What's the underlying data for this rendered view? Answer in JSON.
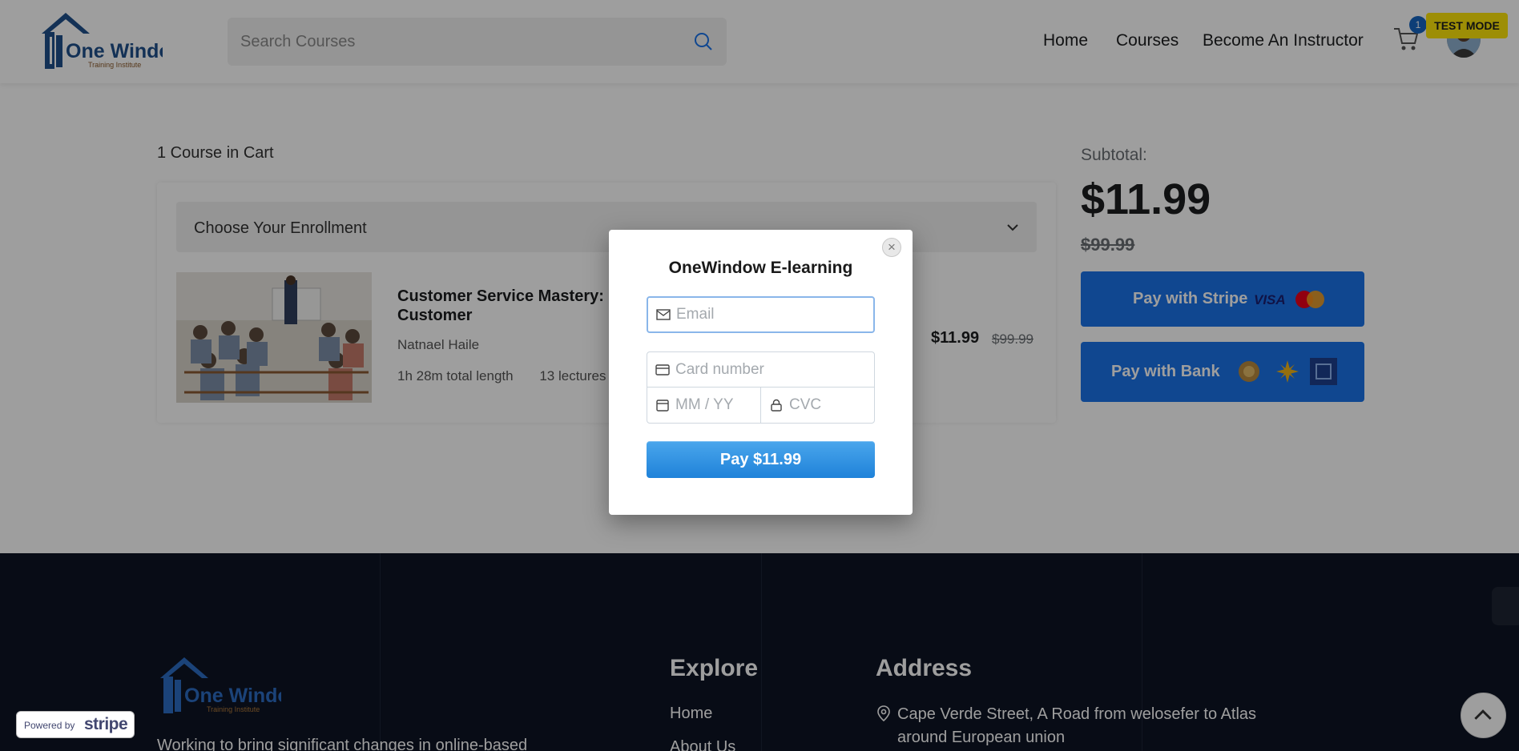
{
  "header": {
    "logo_text": "One Window",
    "logo_sub": "Training Institute",
    "search_placeholder": "Search Courses",
    "nav": [
      "Home",
      "Courses",
      "Become An Instructor"
    ],
    "cart_count": "1",
    "test_mode": "TEST MODE"
  },
  "cart": {
    "count_label": "1 Course in Cart",
    "enrollment_label": "Choose Your Enrollment",
    "course": {
      "title": "Customer Service Mastery: D Customer",
      "instructor": "Natnael Haile",
      "length": "1h 28m total length",
      "lectures": "13 lectures",
      "price": "$11.99",
      "old_price": "$99.99"
    }
  },
  "summary": {
    "subtotal_label": "Subtotal:",
    "subtotal": "$11.99",
    "old_price": "$99.99",
    "pay_stripe": "Pay with Stripe",
    "visa": "VISA",
    "pay_bank": "Pay with Bank"
  },
  "modal": {
    "title": "OneWindow E-learning",
    "email_placeholder": "Email",
    "card_placeholder": "Card number",
    "expiry_placeholder": "MM / YY",
    "cvc_placeholder": "CVC",
    "pay_label": "Pay $11.99",
    "close": "×"
  },
  "powered": {
    "text": "Powered by",
    "brand": "stripe"
  },
  "footer": {
    "logo_text": "One Window",
    "logo_sub": "Training Institute",
    "tagline": "Working to bring significant changes in online-based",
    "explore_heading": "Explore",
    "explore_links": [
      "Home",
      "About Us"
    ],
    "address_heading": "Address",
    "address": "Cape Verde Street, A Road from welosefer to Atlas around European union"
  },
  "colors": {
    "primary_blue": "#1a73e8",
    "footer_bg": "#0d1424",
    "test_mode": "#fde50a",
    "stripe_button": "#2d8fe0"
  },
  "icons": {
    "search": "search-icon",
    "cart": "cart-icon",
    "chevron": "chevron-down-icon",
    "email": "mail-icon",
    "card": "credit-card-icon",
    "calendar": "calendar-icon",
    "lock": "lock-icon",
    "location": "location-pin-icon",
    "up": "chevron-up-icon"
  }
}
